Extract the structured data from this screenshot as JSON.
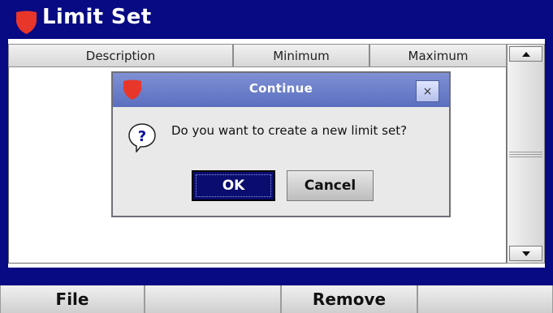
{
  "window": {
    "title": "Limit Set",
    "accent": "#070a82",
    "shield_color": "#e8362b"
  },
  "table": {
    "columns": [
      "Description",
      "Minimum",
      "Maximum"
    ]
  },
  "dialog": {
    "title": "Continue",
    "close_label": "×",
    "message": "Do you want to create a new limit set?",
    "ok_label": "OK",
    "cancel_label": "Cancel",
    "icon": "question-icon"
  },
  "softkeys": [
    "File",
    "",
    "Remove",
    ""
  ]
}
